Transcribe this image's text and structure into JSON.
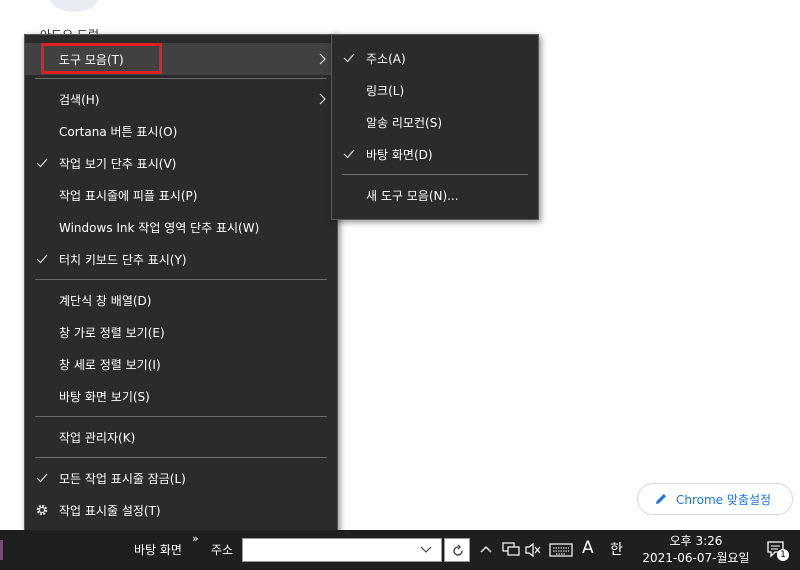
{
  "desktop": {
    "icon_label": "아도오 드럼"
  },
  "main_menu": {
    "toolbars": "도구 모음(T)",
    "search": "검색(H)",
    "cortana": "Cortana 버튼 표시(O)",
    "task_view": "작업 보기 단추 표시(V)",
    "people": "작업 표시줄에 피플 표시(P)",
    "ink": "Windows Ink 작업 영역 단추 표시(W)",
    "touch_keyboard": "터치 키보드 단추 표시(Y)",
    "cascade": "계단식 창 배열(D)",
    "stacked": "창 가로 정렬 보기(E)",
    "side_by_side": "창 세로 정렬 보기(I)",
    "show_desktop": "바탕 화면 보기(S)",
    "task_manager": "작업 관리자(K)",
    "lock": "모든 작업 표시줄 잠금(L)",
    "settings": "작업 표시줄 설정(T)"
  },
  "sub_menu": {
    "address": "주소(A)",
    "links": "링크(L)",
    "remote": "알송 리모컨(S)",
    "desktop": "바탕 화면(D)",
    "new_toolbar": "새 도구 모음(N)..."
  },
  "chrome_button": {
    "label": "Chrome 맞춤설정"
  },
  "taskbar": {
    "desktop_toolbar": "바탕 화면",
    "chevron": "»",
    "address_label": "주소",
    "address_value": "",
    "ime": "한",
    "keyboard_letter": "A",
    "time": "오후 3:26",
    "date": "2021-06-07-월요일",
    "notification_count": "1"
  },
  "colors": {
    "menu_bg": "#2b2b2b",
    "highlight_border": "#e02020",
    "chrome_accent": "#1a73e8",
    "taskbar_bg": "#1f1f1f"
  }
}
